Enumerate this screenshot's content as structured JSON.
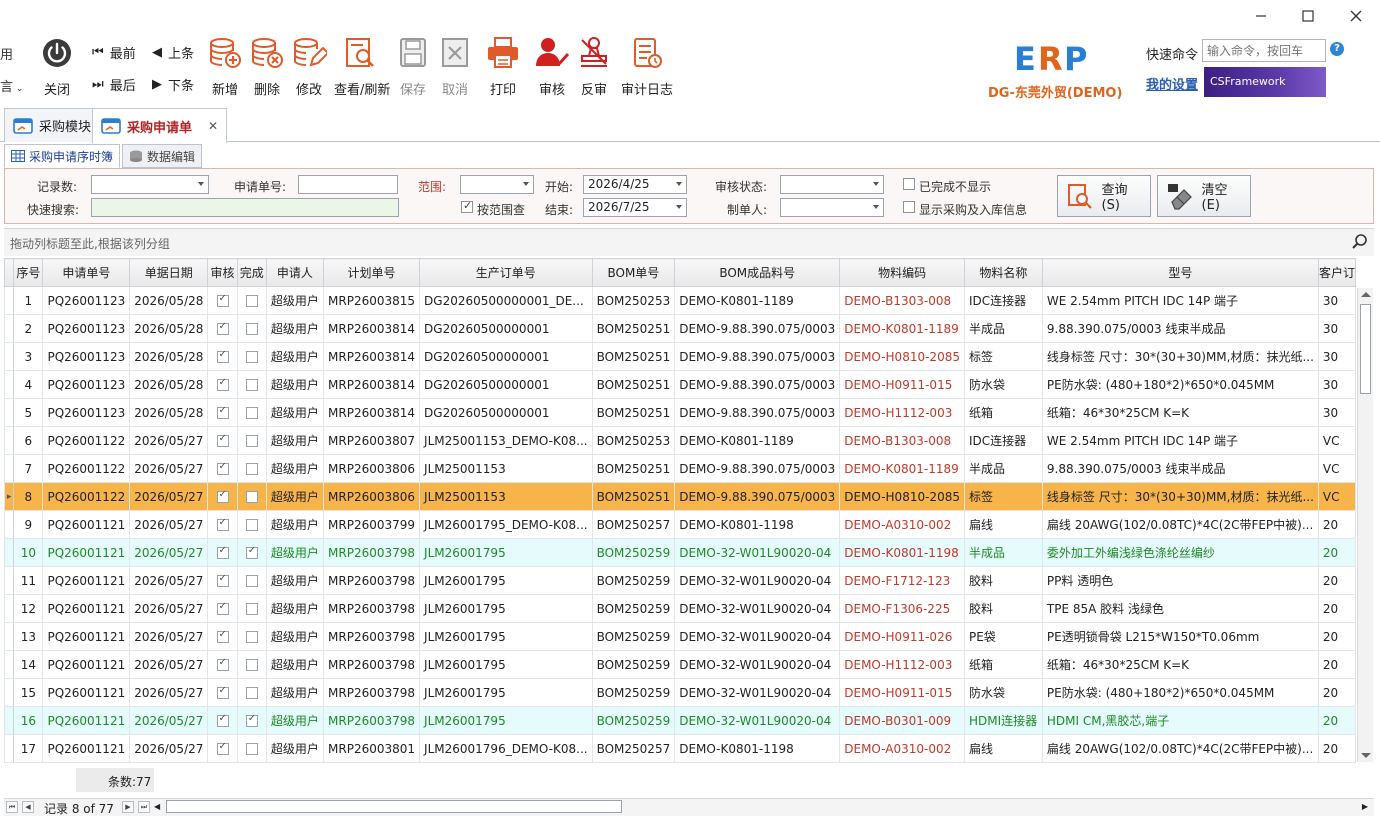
{
  "window": {
    "minimize_icon": "minimize-icon",
    "maximize_icon": "maximize-icon",
    "close_icon": "close-icon"
  },
  "toolbar": {
    "left_stub_top": "用",
    "left_stub_bottom": "言",
    "close_label": "关闭",
    "first_label": "最前",
    "prev_label": "上条",
    "last_label": "最后",
    "next_label": "下条",
    "add_label": "新增",
    "delete_label": "删除",
    "edit_label": "修改",
    "view_refresh_label": "查看/刷新",
    "save_label": "保存",
    "cancel_label": "取消",
    "print_label": "打印",
    "approve_label": "审核",
    "unapprove_label": "反审",
    "audit_log_label": "审计日志"
  },
  "brand": {
    "logo_text": "ERP",
    "company": "DG-东莞外贸(DEMO)",
    "accent": "#e0641a"
  },
  "quick": {
    "label": "快速命令",
    "placeholder": "输入命令，按回车",
    "my_settings": "我的设置",
    "banner": "CSFramework"
  },
  "doc_tabs": [
    {
      "label": "采购模块"
    },
    {
      "label": "采购申请单",
      "active": true
    }
  ],
  "inner_tabs": [
    {
      "label": "采购申请序时簿",
      "active": true
    },
    {
      "label": "数据编辑"
    }
  ],
  "filter": {
    "record_count_label": "记录数:",
    "record_count_value": "",
    "quick_search_label": "快速搜索:",
    "quick_search_value": "",
    "req_no_label": "申请单号:",
    "req_no_value": "",
    "range_label": "范围:",
    "range_value": "",
    "by_range_label": "按范围查",
    "start_label": "开始:",
    "start_value": "2026/4/25",
    "end_label": "结束:",
    "end_value": "2026/7/25",
    "audit_status_label": "审核状态:",
    "audit_status_value": "",
    "maker_label": "制单人:",
    "maker_value": "",
    "hide_done_label": "已完成不显示",
    "show_inbound_label": "显示采购及入库信息",
    "query_button": "查询(S)",
    "clear_button": "清空(E)"
  },
  "group_hint": "拖动列标题至此,根据该列分组",
  "grid": {
    "columns": [
      "序号",
      "申请单号",
      "单据日期",
      "审核",
      "完成",
      "申请人",
      "计划单号",
      "生产订单号",
      "BOM单号",
      "BOM成品料号",
      "物料编码",
      "物料名称",
      "型号",
      "客户订"
    ],
    "rows": [
      [
        "1",
        "PQ26001123",
        "2026/05/28",
        true,
        false,
        "超级用户",
        "MRP26003815",
        "DG20260500000001_DE...",
        "BOM250253",
        "DEMO-K0801-1189",
        "DEMO-B1303-008",
        "IDC连接器",
        "WE 2.54mm PITCH IDC 14P 端子",
        "30"
      ],
      [
        "2",
        "PQ26001123",
        "2026/05/28",
        true,
        false,
        "超级用户",
        "MRP26003814",
        "DG20260500000001",
        "BOM250251",
        "DEMO-9.88.390.075/0003",
        "DEMO-K0801-1189",
        "半成品",
        "9.88.390.075/0003 线束半成品",
        "30"
      ],
      [
        "3",
        "PQ26001123",
        "2026/05/28",
        true,
        false,
        "超级用户",
        "MRP26003814",
        "DG20260500000001",
        "BOM250251",
        "DEMO-9.88.390.075/0003",
        "DEMO-H0810-2085",
        "标签",
        "线身标签 尺寸：30*(30+30)MM,材质：抹光纸...",
        "30"
      ],
      [
        "4",
        "PQ26001123",
        "2026/05/28",
        true,
        false,
        "超级用户",
        "MRP26003814",
        "DG20260500000001",
        "BOM250251",
        "DEMO-9.88.390.075/0003",
        "DEMO-H0911-015",
        "防水袋",
        "PE防水袋: (480+180*2)*650*0.045MM",
        "30"
      ],
      [
        "5",
        "PQ26001123",
        "2026/05/28",
        true,
        false,
        "超级用户",
        "MRP26003814",
        "DG20260500000001",
        "BOM250251",
        "DEMO-9.88.390.075/0003",
        "DEMO-H1112-003",
        "纸箱",
        "纸箱：46*30*25CM K=K",
        "30"
      ],
      [
        "6",
        "PQ26001122",
        "2026/05/27",
        true,
        false,
        "超级用户",
        "MRP26003807",
        "JLM25001153_DEMO-K08...",
        "BOM250253",
        "DEMO-K0801-1189",
        "DEMO-B1303-008",
        "IDC连接器",
        "WE 2.54mm PITCH IDC 14P 端子",
        "VC"
      ],
      [
        "7",
        "PQ26001122",
        "2026/05/27",
        true,
        false,
        "超级用户",
        "MRP26003806",
        "JLM25001153",
        "BOM250251",
        "DEMO-9.88.390.075/0003",
        "DEMO-K0801-1189",
        "半成品",
        "9.88.390.075/0003 线束半成品",
        "VC"
      ],
      [
        "8",
        "PQ26001122",
        "2026/05/27",
        true,
        false,
        "超级用户",
        "MRP26003806",
        "JLM25001153",
        "BOM250251",
        "DEMO-9.88.390.075/0003",
        "DEMO-H0810-2085",
        "标签",
        "线身标签 尺寸：30*(30+30)MM,材质：抹光纸...",
        "VC"
      ],
      [
        "9",
        "PQ26001121",
        "2026/05/27",
        true,
        false,
        "超级用户",
        "MRP26003799",
        "JLM26001795_DEMO-K08...",
        "BOM250257",
        "DEMO-K0801-1198",
        "DEMO-A0310-002",
        "扁线",
        "扁线 20AWG(102/0.08TC)*4C(2C带FEP中被)...",
        "20"
      ],
      [
        "10",
        "PQ26001121",
        "2026/05/27",
        true,
        true,
        "超级用户",
        "MRP26003798",
        "JLM26001795",
        "BOM250259",
        "DEMO-32-W01L90020-04",
        "DEMO-K0801-1198",
        "半成品",
        "委外加工外编浅绿色涤纶丝编纱",
        "20"
      ],
      [
        "11",
        "PQ26001121",
        "2026/05/27",
        true,
        false,
        "超级用户",
        "MRP26003798",
        "JLM26001795",
        "BOM250259",
        "DEMO-32-W01L90020-04",
        "DEMO-F1712-123",
        "胶料",
        "PP料 透明色",
        "20"
      ],
      [
        "12",
        "PQ26001121",
        "2026/05/27",
        true,
        false,
        "超级用户",
        "MRP26003798",
        "JLM26001795",
        "BOM250259",
        "DEMO-32-W01L90020-04",
        "DEMO-F1306-225",
        "胶料",
        "TPE 85A 胶料 浅绿色",
        "20"
      ],
      [
        "13",
        "PQ26001121",
        "2026/05/27",
        true,
        false,
        "超级用户",
        "MRP26003798",
        "JLM26001795",
        "BOM250259",
        "DEMO-32-W01L90020-04",
        "DEMO-H0911-026",
        "PE袋",
        "PE透明锁骨袋 L215*W150*T0.06mm",
        "20"
      ],
      [
        "14",
        "PQ26001121",
        "2026/05/27",
        true,
        false,
        "超级用户",
        "MRP26003798",
        "JLM26001795",
        "BOM250259",
        "DEMO-32-W01L90020-04",
        "DEMO-H1112-003",
        "纸箱",
        "纸箱：46*30*25CM K=K",
        "20"
      ],
      [
        "15",
        "PQ26001121",
        "2026/05/27",
        true,
        false,
        "超级用户",
        "MRP26003798",
        "JLM26001795",
        "BOM250259",
        "DEMO-32-W01L90020-04",
        "DEMO-H0911-015",
        "防水袋",
        "PE防水袋: (480+180*2)*650*0.045MM",
        "20"
      ],
      [
        "16",
        "PQ26001121",
        "2026/05/27",
        true,
        true,
        "超级用户",
        "MRP26003798",
        "JLM26001795",
        "BOM250259",
        "DEMO-32-W01L90020-04",
        "DEMO-B0301-009",
        "HDMI连接器",
        "HDMI CM,黑胶芯,端子",
        "20"
      ],
      [
        "17",
        "PQ26001121",
        "2026/05/27",
        true,
        false,
        "超级用户",
        "MRP26003801",
        "JLM26001796_DEMO-K08...",
        "BOM250257",
        "DEMO-K0801-1198",
        "DEMO-A0310-002",
        "扁线",
        "扁线 20AWG(102/0.08TC)*4C(2C带FEP中被)...",
        "20"
      ]
    ],
    "selected_row_index": 7,
    "green_row_indices": [
      9,
      15
    ],
    "selected_color": "#f7b449",
    "green_text_color": "#1d8a26",
    "code_red_color": "#c0392b"
  },
  "footer": {
    "summary": "条数:77",
    "nav_text": "记录 8 of 77"
  }
}
